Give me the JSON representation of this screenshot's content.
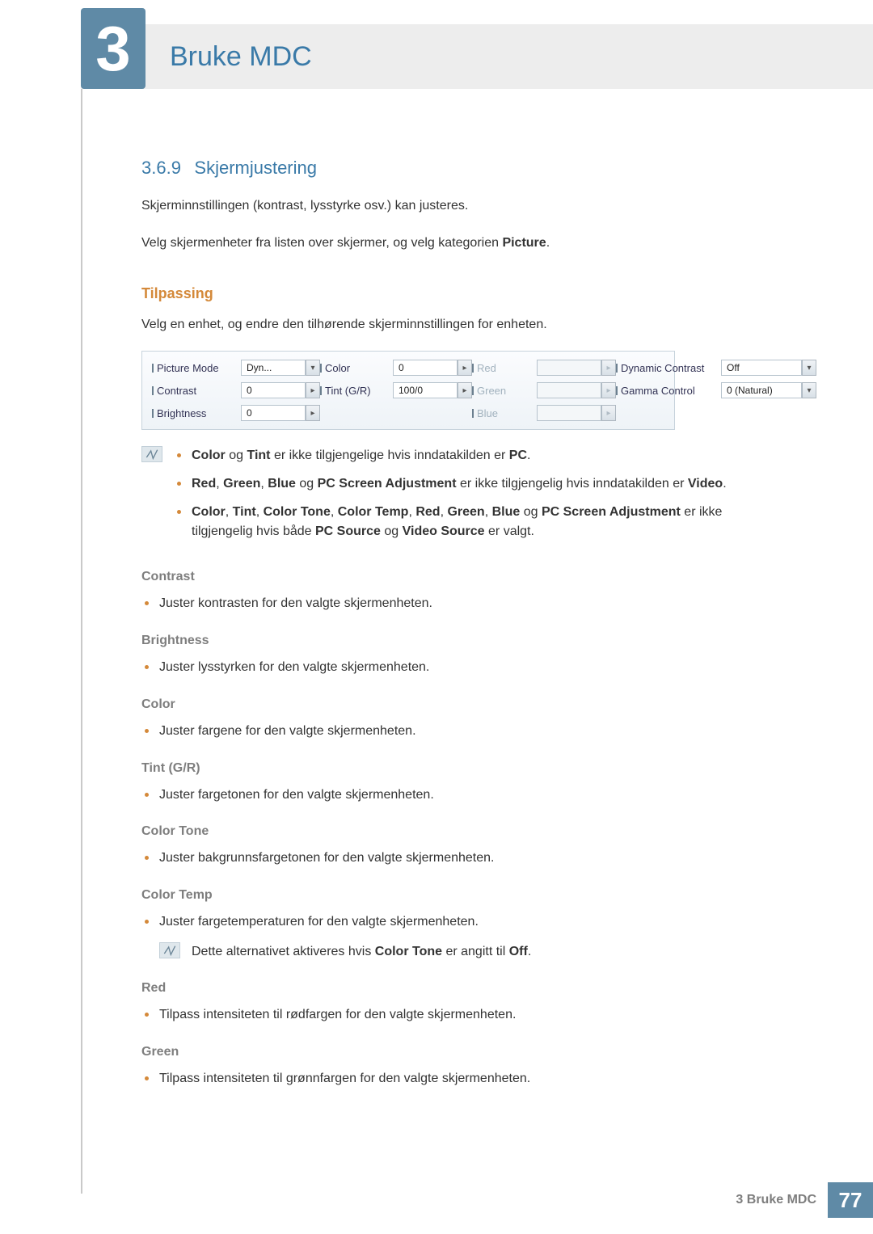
{
  "chapter": {
    "number": "3",
    "title": "Bruke MDC"
  },
  "section": {
    "number": "3.6.9",
    "title": "Skjermjustering"
  },
  "intro": {
    "p1": "Skjerminnstillingen (kontrast, lysstyrke osv.) kan justeres.",
    "p2_a": "Velg skjermenheter fra listen over skjermer, og velg kategorien ",
    "p2_b": "Picture",
    "p2_c": "."
  },
  "tilpassing": {
    "heading": "Tilpassing",
    "p": "Velg en enhet, og endre den tilhørende skjerminnstillingen for enheten."
  },
  "panel": {
    "pictureMode": {
      "label": "Picture Mode",
      "value": "Dyn..."
    },
    "color": {
      "label": "Color",
      "value": "0"
    },
    "red": {
      "label": "Red",
      "value": ""
    },
    "dynContrast": {
      "label": "Dynamic Contrast",
      "value": "Off"
    },
    "contrast": {
      "label": "Contrast",
      "value": "0"
    },
    "tint": {
      "label": "Tint (G/R)",
      "value": "100/0"
    },
    "green": {
      "label": "Green",
      "value": ""
    },
    "gamma": {
      "label": "Gamma Control",
      "value": "0 (Natural)"
    },
    "brightness": {
      "label": "Brightness",
      "value": "0"
    },
    "blue": {
      "label": "Blue",
      "value": ""
    }
  },
  "notes": {
    "n1": {
      "a": "Color",
      "b": " og ",
      "c": "Tint",
      "d": " er ikke tilgjengelige hvis inndatakilden er ",
      "e": "PC",
      "f": "."
    },
    "n2": {
      "a": "Red",
      "b": ", ",
      "c": "Green",
      "d": ", ",
      "e": "Blue",
      "f": " og ",
      "g": "PC Screen Adjustment",
      "h": " er ikke tilgjengelig hvis inndatakilden er ",
      "i": "Video",
      "j": "."
    },
    "n3": {
      "a": "Color",
      "b": ", ",
      "c": "Tint",
      "d": ", ",
      "e": "Color Tone",
      "f": ", ",
      "g": "Color Temp",
      "h": ", ",
      "i": "Red",
      "j": ", ",
      "k": "Green",
      "l": ", ",
      "m": "Blue",
      "n": " og ",
      "o": "PC Screen Adjustment",
      "p": " er ikke tilgjengelig hvis både ",
      "q": "PC Source",
      "r": " og ",
      "s": "Video Source",
      "t": " er valgt."
    }
  },
  "items": {
    "contrast": {
      "h": "Contrast",
      "t": "Juster kontrasten for den valgte skjermenheten."
    },
    "brightness": {
      "h": "Brightness",
      "t": "Juster lysstyrken for den valgte skjermenheten."
    },
    "color": {
      "h": "Color",
      "t": "Juster fargene for den valgte skjermenheten."
    },
    "tint": {
      "h": "Tint (G/R)",
      "t": "Juster fargetonen for den valgte skjermenheten."
    },
    "colortone": {
      "h": "Color Tone",
      "t": "Juster bakgrunnsfargetonen for den valgte skjermenheten."
    },
    "colortemp": {
      "h": "Color Temp",
      "t": "Juster fargetemperaturen for den valgte skjermenheten.",
      "note_a": "Dette alternativet aktiveres hvis ",
      "note_b": "Color Tone",
      "note_c": " er angitt til ",
      "note_d": "Off",
      "note_e": "."
    },
    "red": {
      "h": "Red",
      "t": "Tilpass intensiteten til rødfargen for den valgte skjermenheten."
    },
    "green": {
      "h": "Green",
      "t": "Tilpass intensiteten til grønnfargen for den valgte skjermenheten."
    }
  },
  "footer": {
    "label": "3 Bruke MDC",
    "page": "77"
  }
}
